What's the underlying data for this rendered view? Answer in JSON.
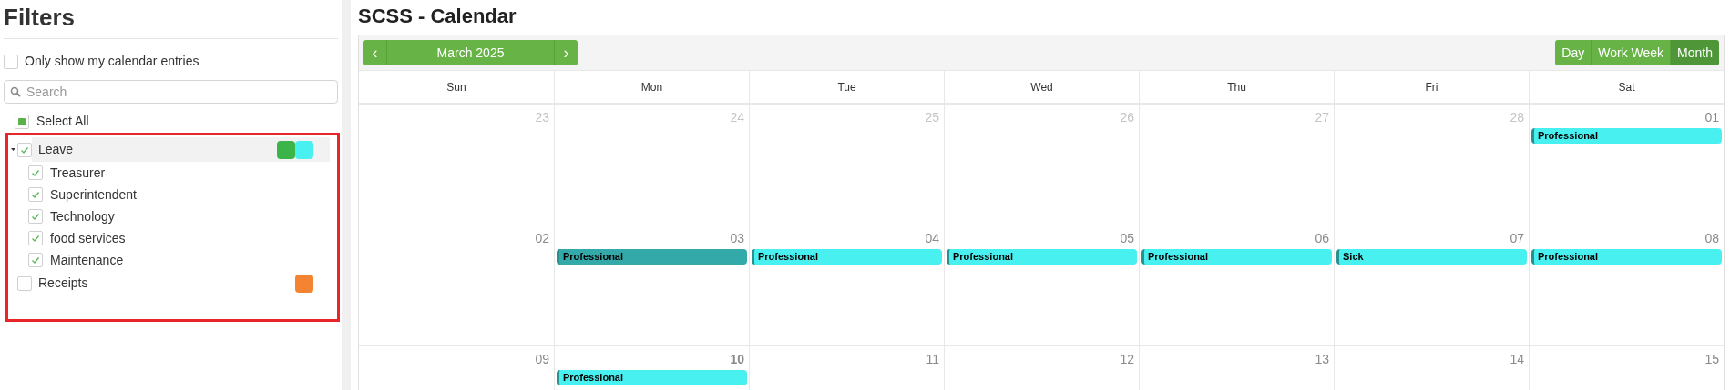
{
  "sidebar": {
    "title": "Filters",
    "only_mine": {
      "label": "Only show my calendar entries",
      "checked": false
    },
    "search": {
      "placeholder": "Search"
    },
    "select_all": {
      "label": "Select All",
      "indeterminate": true
    },
    "groups": [
      {
        "label": "Leave",
        "checked": true,
        "expanded": true,
        "selected": true,
        "swatches": [
          {
            "color": "#3bb54a"
          },
          {
            "color": "#48f0f0"
          }
        ],
        "children": [
          {
            "label": "Treasurer",
            "checked": true
          },
          {
            "label": "Superintendent",
            "checked": true
          },
          {
            "label": "Technology",
            "checked": true
          },
          {
            "label": "food services",
            "checked": true
          },
          {
            "label": "Maintenance",
            "checked": true
          }
        ]
      },
      {
        "label": "Receipts",
        "checked": false,
        "selected": false,
        "swatches": [
          {
            "color": "#f58432"
          }
        ]
      }
    ]
  },
  "calendar": {
    "title": "SCSS - Calendar",
    "prev": "‹",
    "period": "March 2025",
    "next": "›",
    "views": [
      {
        "label": "Day",
        "selected": false
      },
      {
        "label": "Work Week",
        "selected": false
      },
      {
        "label": "Month",
        "selected": true
      }
    ],
    "weekdays": [
      "Sun",
      "Mon",
      "Tue",
      "Wed",
      "Thu",
      "Fri",
      "Sat"
    ],
    "weeks": [
      [
        {
          "day": "23",
          "muted": true,
          "today": false
        },
        {
          "day": "24",
          "muted": true,
          "today": false
        },
        {
          "day": "25",
          "muted": true,
          "today": false
        },
        {
          "day": "26",
          "muted": true,
          "today": false
        },
        {
          "day": "27",
          "muted": true,
          "today": false
        },
        {
          "day": "28",
          "muted": true,
          "today": false
        },
        {
          "day": "01",
          "muted": false,
          "today": false,
          "events": [
            {
              "title": "Professional",
              "color": "#48f0f0"
            }
          ]
        }
      ],
      [
        {
          "day": "02",
          "muted": false,
          "today": false
        },
        {
          "day": "03",
          "muted": false,
          "today": false,
          "events": [
            {
              "title": "Professional",
              "color": "#33a9a9"
            }
          ]
        },
        {
          "day": "04",
          "muted": false,
          "today": false,
          "events": [
            {
              "title": "Professional",
              "color": "#48f0f0"
            }
          ]
        },
        {
          "day": "05",
          "muted": false,
          "today": false,
          "events": [
            {
              "title": "Professional",
              "color": "#48f0f0"
            }
          ]
        },
        {
          "day": "06",
          "muted": false,
          "today": false,
          "events": [
            {
              "title": "Professional",
              "color": "#48f0f0"
            }
          ]
        },
        {
          "day": "07",
          "muted": false,
          "today": false,
          "events": [
            {
              "title": "Sick",
              "color": "#48f0f0"
            }
          ]
        },
        {
          "day": "08",
          "muted": false,
          "today": false,
          "events": [
            {
              "title": "Professional",
              "color": "#48f0f0"
            }
          ]
        }
      ],
      [
        {
          "day": "09",
          "muted": false,
          "today": false
        },
        {
          "day": "10",
          "muted": false,
          "today": true,
          "events": [
            {
              "title": "Professional",
              "color": "#48f0f0"
            }
          ]
        },
        {
          "day": "11",
          "muted": false,
          "today": false
        },
        {
          "day": "12",
          "muted": false,
          "today": false
        },
        {
          "day": "13",
          "muted": false,
          "today": false
        },
        {
          "day": "14",
          "muted": false,
          "today": false
        },
        {
          "day": "15",
          "muted": false,
          "today": false
        }
      ]
    ]
  }
}
